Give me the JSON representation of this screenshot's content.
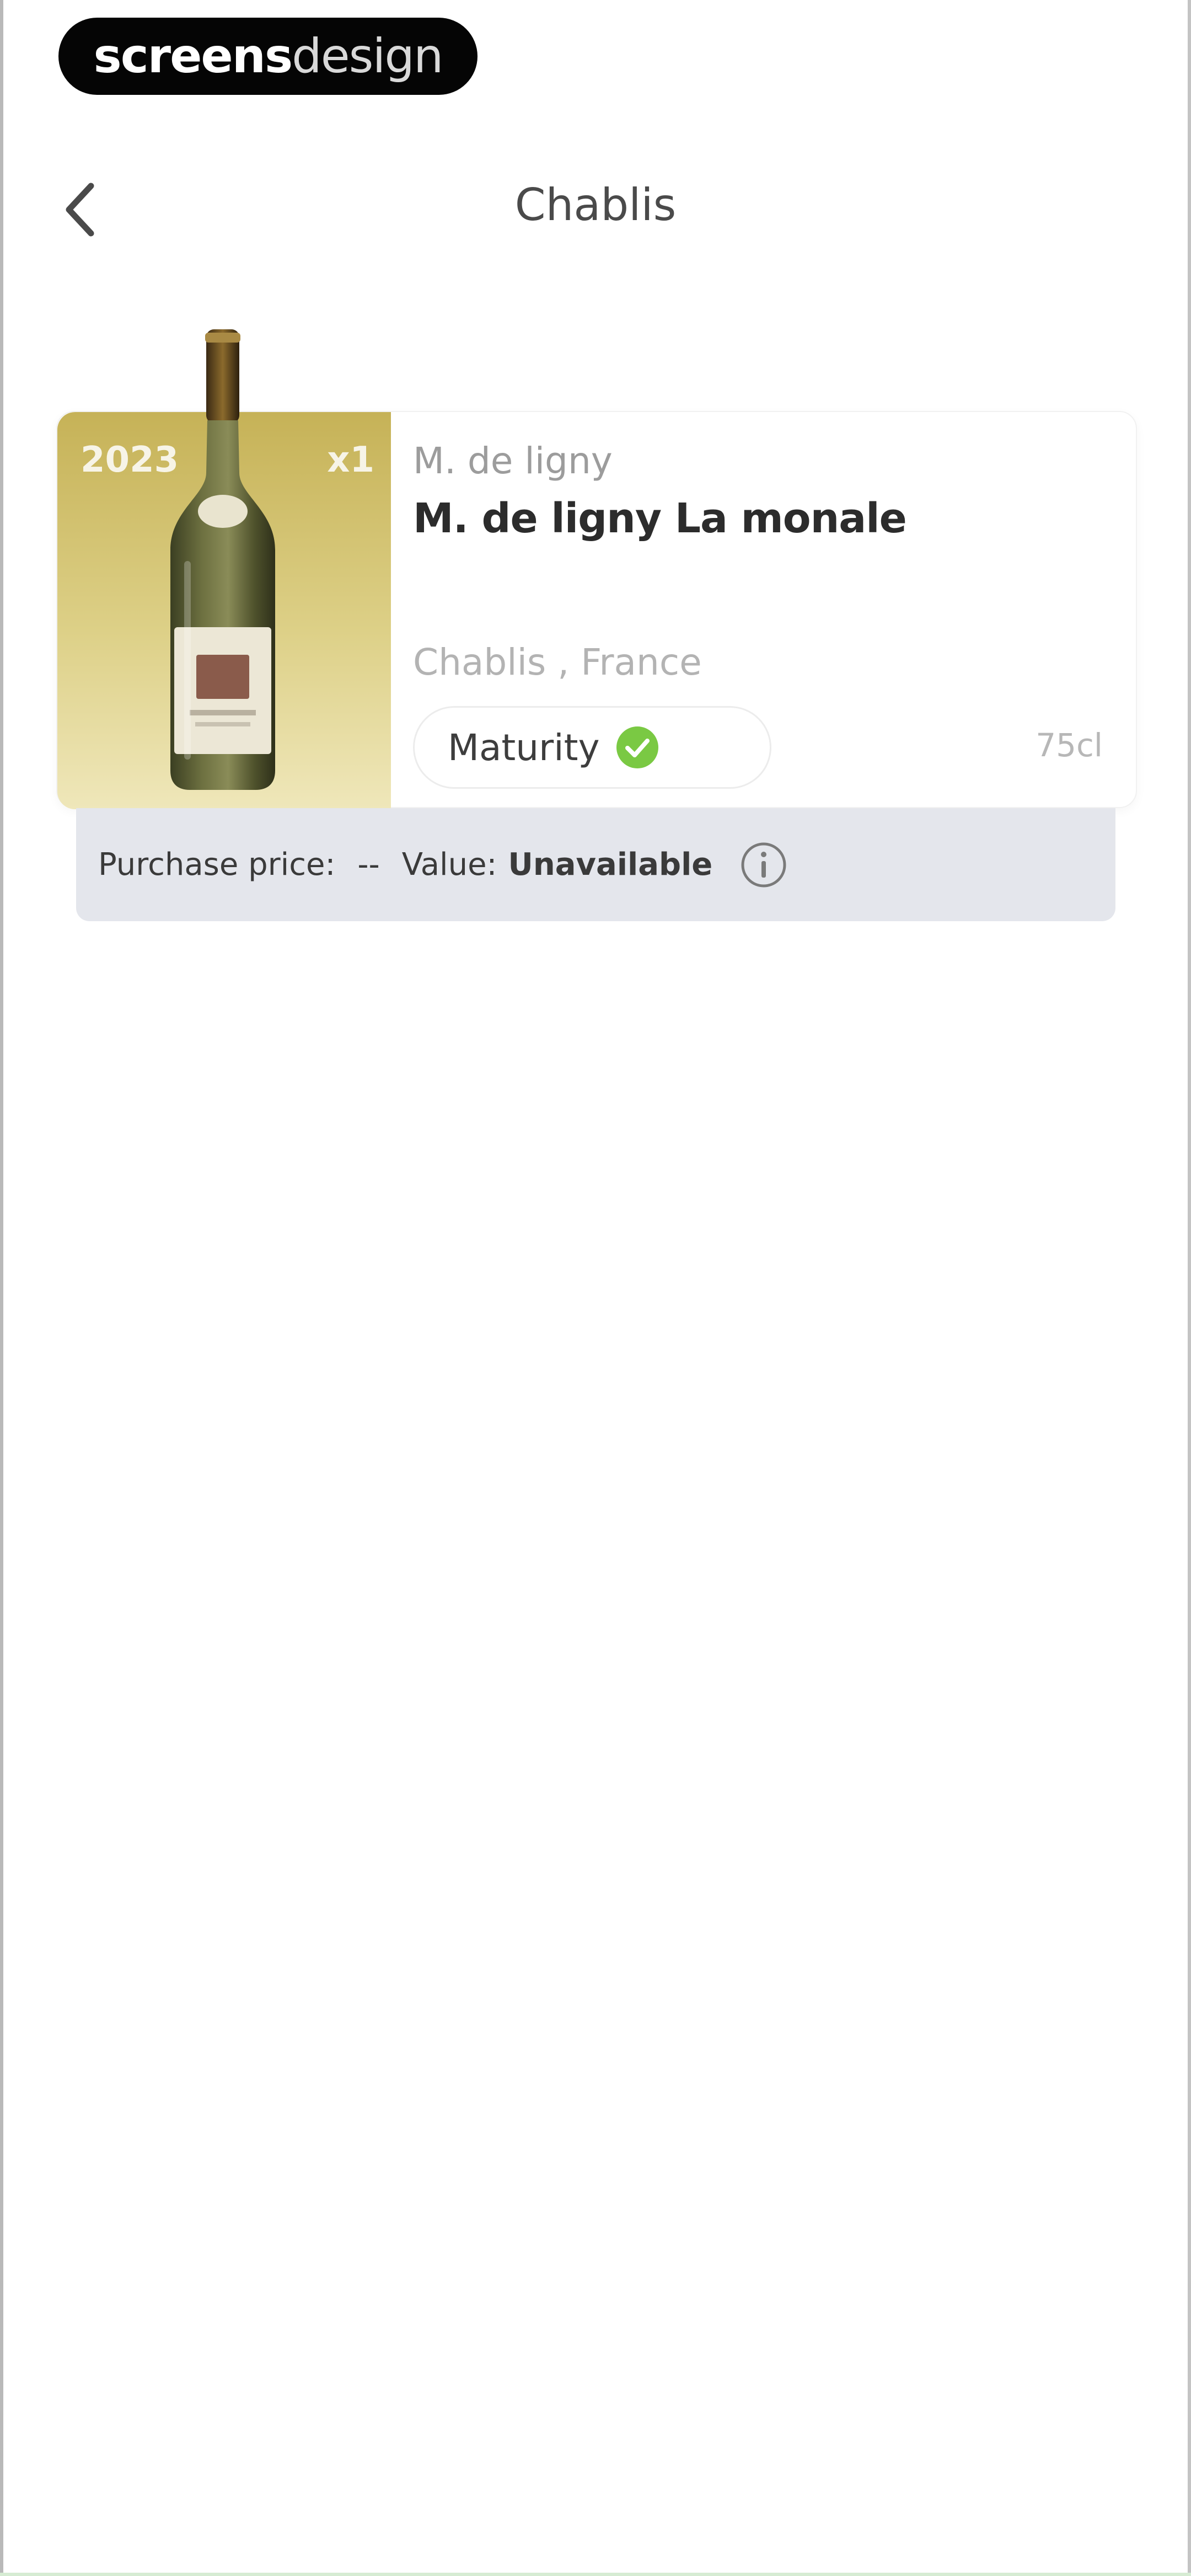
{
  "watermark": {
    "part1": "screens",
    "part2": "design"
  },
  "header": {
    "back_icon": "chevron-left-icon",
    "title": "Chablis"
  },
  "wine_card": {
    "vintage": "2023",
    "quantity": "x1",
    "producer": "M. de ligny",
    "name": "M. de ligny La monale",
    "region": "Chablis , France",
    "maturity_label": "Maturity",
    "maturity_icon": "check-circle-icon",
    "maturity_color": "#7ac943",
    "volume": "75cl",
    "image_gradient_top": "#c6b257",
    "image_gradient_bottom": "#efe7ba"
  },
  "value_bar": {
    "purchase_label": "Purchase price:",
    "purchase_value": "--",
    "value_label": "Value:",
    "value_value": "Unavailable",
    "info_icon": "info-icon"
  }
}
